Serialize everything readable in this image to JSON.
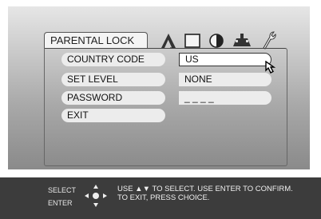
{
  "menu": {
    "title": "PARENTAL LOCK",
    "items": [
      {
        "label": "COUNTRY CODE",
        "value": "US"
      },
      {
        "label": "SET LEVEL",
        "value": "NONE"
      },
      {
        "label": "PASSWORD",
        "value": "_ _ _ _"
      },
      {
        "label": "EXIT"
      }
    ]
  },
  "icons": [
    "language-icon",
    "display-icon",
    "audio-icon",
    "speaker-icon",
    "wrench-icon"
  ],
  "help": {
    "select_label": "SELECT",
    "enter_label": "ENTER",
    "line1": "USE ▲▼ TO SELECT.  USE ENTER TO CONFIRM.",
    "line2": "TO EXIT, PRESS CHOICE."
  },
  "colors": {
    "accent": "#ececec",
    "bar": "#3c3c3c"
  }
}
